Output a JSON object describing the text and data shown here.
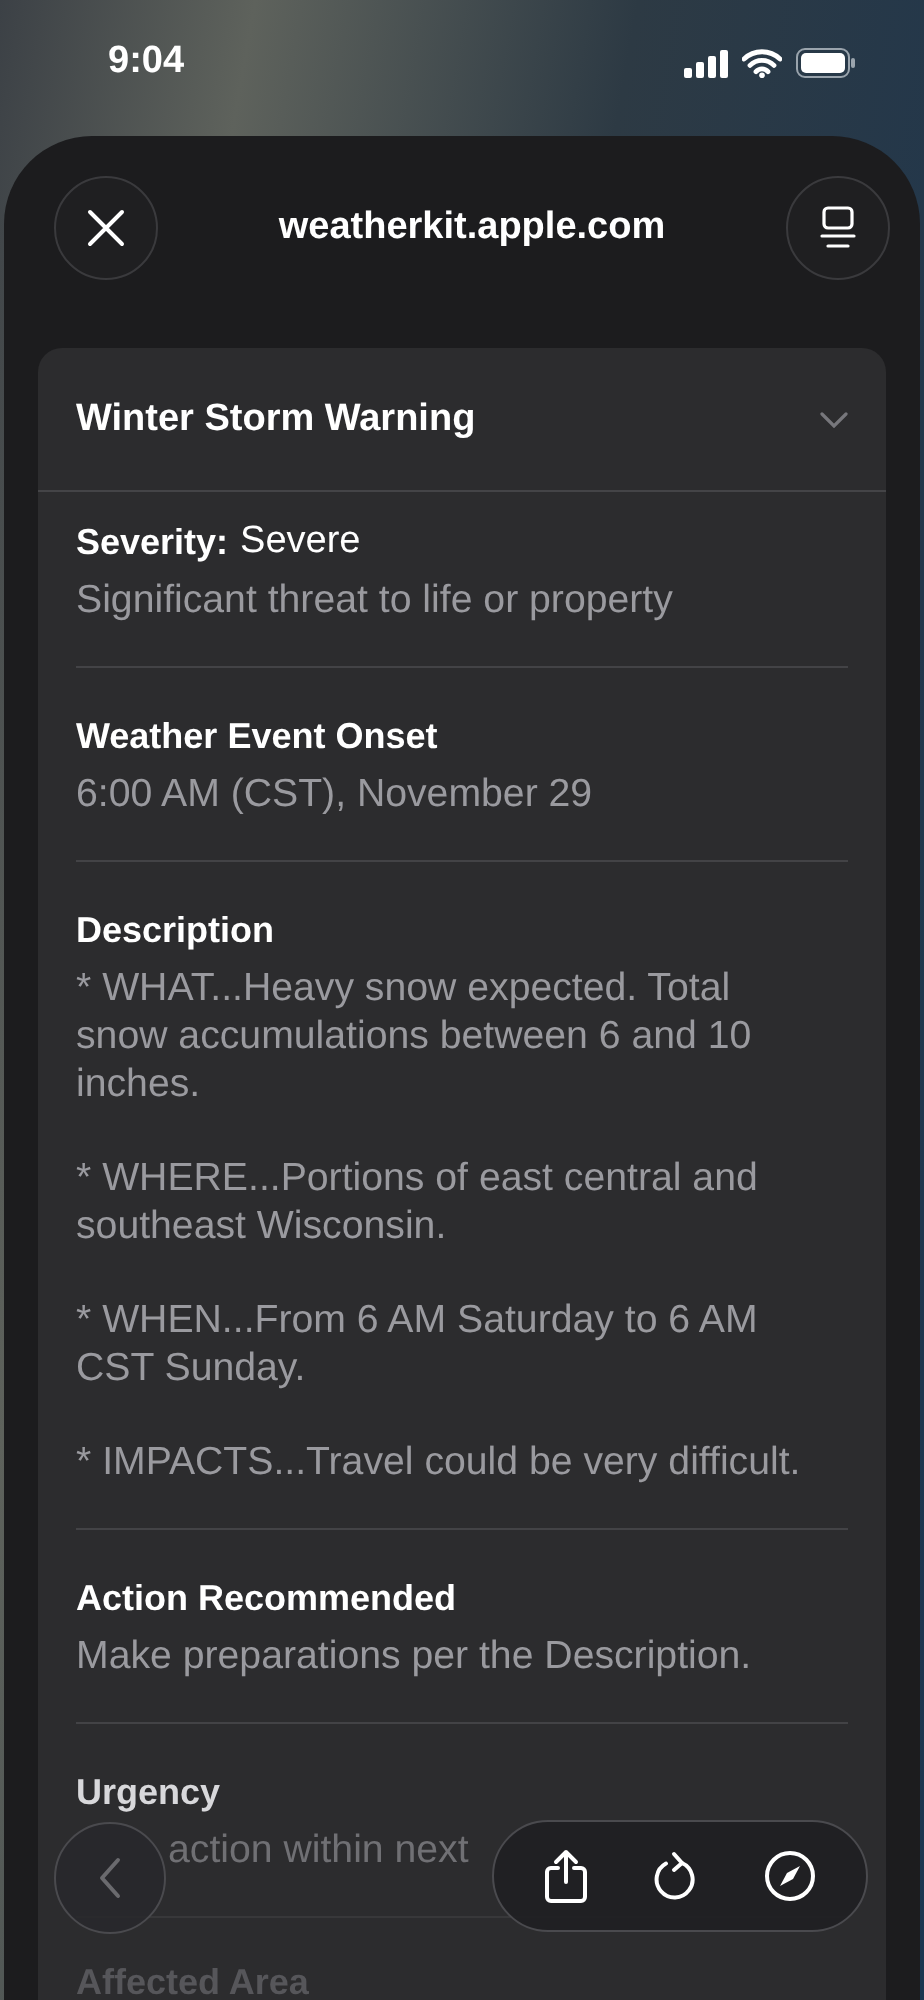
{
  "status_bar": {
    "time": "9:04"
  },
  "header": {
    "title": "weatherkit.apple.com"
  },
  "alert": {
    "title": "Winter Storm Warning",
    "expanded": true,
    "sections": [
      {
        "kind": "inline",
        "heading": "Severity:",
        "value": "Severe",
        "paragraphs": [
          "Significant threat to life or property"
        ]
      },
      {
        "kind": "block",
        "heading": "Weather Event Onset",
        "paragraphs": [
          "6:00 AM (CST), November 29"
        ]
      },
      {
        "kind": "block",
        "heading": "Description",
        "paragraphs": [
          "* WHAT...Heavy snow expected. Total snow accumulations between 6 and 10 inches.",
          "* WHERE...Portions of east central and southeast Wisconsin.",
          "* WHEN...From 6 AM Saturday to 6 AM CST Sunday.",
          "* IMPACTS...Travel could be very difficult."
        ]
      },
      {
        "kind": "block",
        "heading": "Action Recommended",
        "paragraphs": [
          "Make preparations per the Description."
        ]
      },
      {
        "kind": "covered",
        "heading": "Urgency",
        "paragraphs": [
          "action within next"
        ]
      },
      {
        "kind": "faded",
        "heading": "Affected Area"
      }
    ]
  },
  "toolbar": {
    "back_disabled": true
  }
}
